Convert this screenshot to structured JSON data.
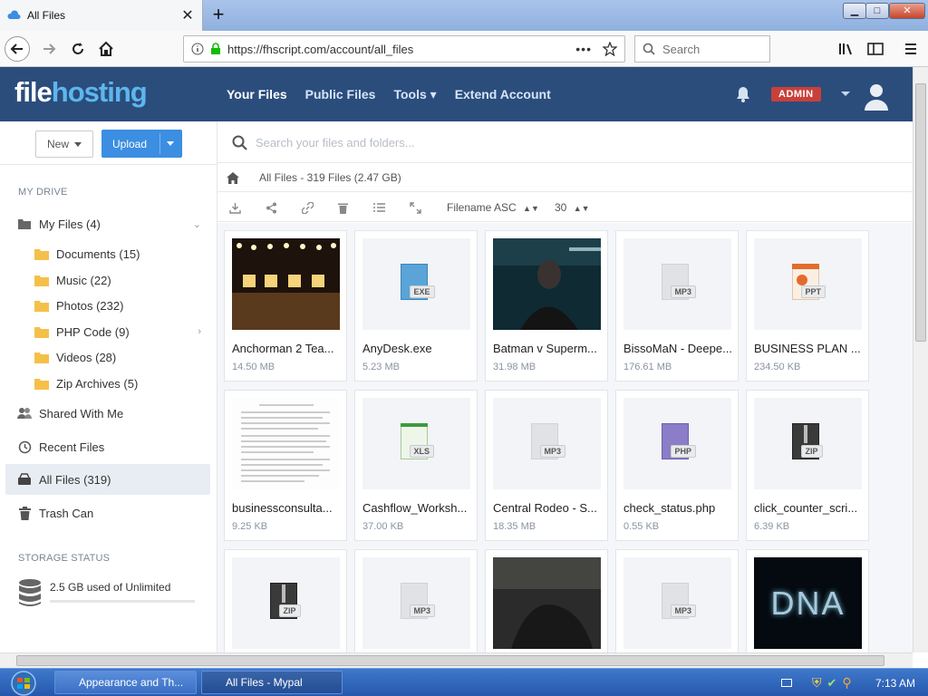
{
  "browser": {
    "tab_title": "All Files",
    "new_tab": "+",
    "tab_close": "✕",
    "url": "https://fhscript.com/account/all_files",
    "search_placeholder": "Search",
    "win_min": "▁",
    "win_max": "□",
    "win_close": "✕"
  },
  "app": {
    "logo_a": "file",
    "logo_b": "hosting",
    "nav": [
      {
        "label": "Your Files"
      },
      {
        "label": "Public Files"
      },
      {
        "label": "Tools ▾"
      },
      {
        "label": "Extend Account"
      }
    ],
    "admin_badge": "ADMIN"
  },
  "sidebar": {
    "new_label": "New",
    "upload_label": "Upload",
    "my_drive_heading": "MY DRIVE",
    "my_files": "My Files (4)",
    "folders": [
      {
        "label": "Documents (15)"
      },
      {
        "label": "Music (22)"
      },
      {
        "label": "Photos (232)"
      },
      {
        "label": "PHP Code (9)"
      },
      {
        "label": "Videos (28)"
      },
      {
        "label": "Zip Archives (5)"
      }
    ],
    "shared": "Shared With Me",
    "recent": "Recent Files",
    "all_files": "All Files (319)",
    "trash": "Trash Can",
    "storage_heading": "STORAGE STATUS",
    "storage_text": "2.5 GB used of Unlimited"
  },
  "main": {
    "search_placeholder": "Search your files and folders...",
    "breadcrumb": "All Files - 319 Files (2.47 GB)",
    "sort": "Filename ASC",
    "per_page": "30",
    "files": [
      {
        "name": "Anchorman 2 Tea...",
        "size": "14.50 MB",
        "ext": ""
      },
      {
        "name": "AnyDesk.exe",
        "size": "5.23 MB",
        "ext": "EXE"
      },
      {
        "name": "Batman v Superm...",
        "size": "31.98 MB",
        "ext": ""
      },
      {
        "name": "BissoMaN - Deepe...",
        "size": "176.61 MB",
        "ext": "MP3"
      },
      {
        "name": "BUSINESS PLAN ...",
        "size": "234.50 KB",
        "ext": "PPT"
      },
      {
        "name": "businessconsulta...",
        "size": "9.25 KB",
        "ext": ""
      },
      {
        "name": "Cashflow_Worksh...",
        "size": "37.00 KB",
        "ext": "XLS"
      },
      {
        "name": "Central Rodeo - S...",
        "size": "18.35 MB",
        "ext": "MP3"
      },
      {
        "name": "check_status.php",
        "size": "0.55 KB",
        "ext": "PHP"
      },
      {
        "name": "click_counter_scri...",
        "size": "6.39 KB",
        "ext": "ZIP"
      },
      {
        "name": "",
        "size": "",
        "ext": "ZIP"
      },
      {
        "name": "",
        "size": "",
        "ext": "MP3"
      },
      {
        "name": "",
        "size": "",
        "ext": ""
      },
      {
        "name": "",
        "size": "",
        "ext": "MP3"
      },
      {
        "name": "",
        "size": "",
        "ext": ""
      }
    ],
    "dna_text": "DNA"
  },
  "taskbar": {
    "items": [
      {
        "label": "Appearance and Th..."
      },
      {
        "label": "All Files - Mypal"
      }
    ],
    "clock": "7:13 AM"
  }
}
